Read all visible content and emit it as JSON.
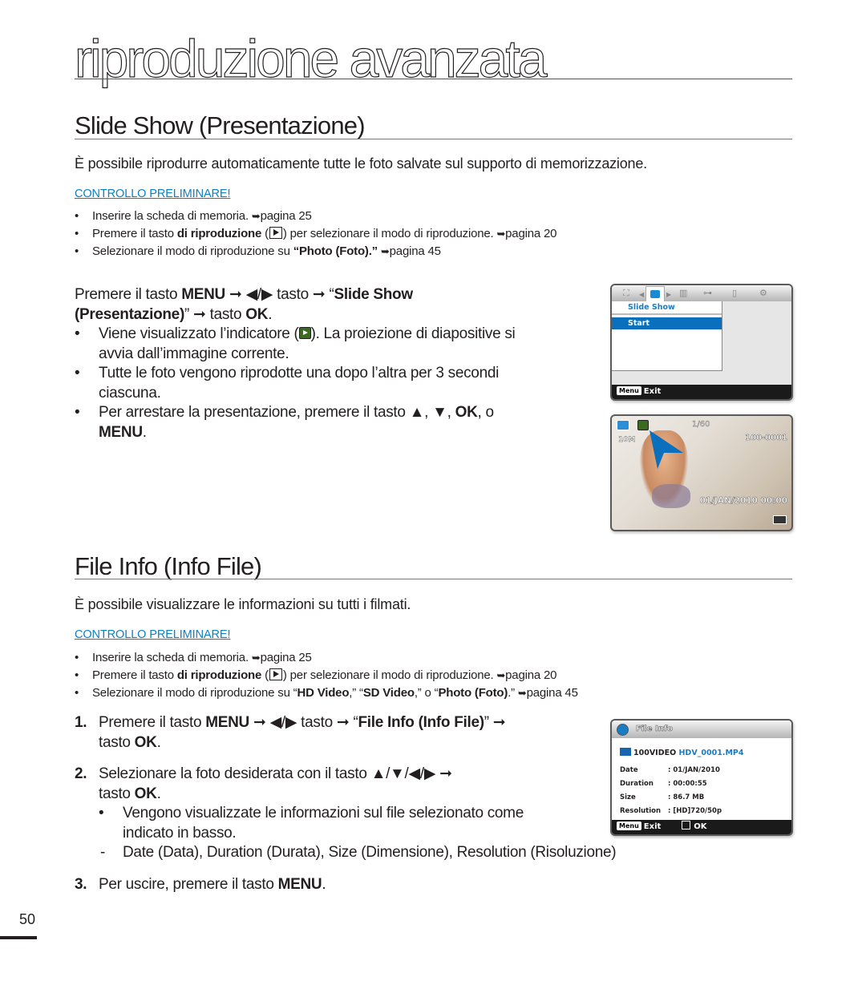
{
  "chapter_title": "riproduzione avanzata",
  "page_number": "50",
  "sections": [
    {
      "title": "Slide Show (Presentazione)",
      "intro": "È possibile riprodurre automaticamente tutte le foto salvate sul supporto di memorizzazione.",
      "precheck_label": "CONTROLLO PRELIMINARE!",
      "precheck_items": [
        {
          "pre": "Inserire la scheda di memoria. ",
          "ref": "pagina 25"
        },
        {
          "pre": "Premere il tasto ",
          "bold": "di riproduzione",
          "mid": ") per selezionare il modo di riproduzione. ",
          "ref": "pagina 20"
        },
        {
          "pre": "Selezionare il modo di riproduzione su ",
          "bold": "“Photo (Foto).”",
          "ref": "pagina 45"
        }
      ],
      "step_line1": {
        "a": "Premere il tasto ",
        "menu": "MENU",
        "b": " tasto ",
        "c": "“",
        "item": "Slide Show"
      },
      "step_line2": {
        "item": "(Presentazione)",
        "a": "” ",
        "b": " tasto ",
        "ok": "OK",
        "end": "."
      },
      "bullets": [
        {
          "pre": "Viene visualizzato l’indicatore (",
          "post": "). La proiezione di diapositive si",
          "cont": "avvia dall’immagine corrente."
        },
        {
          "pre": "Tutte le foto vengono riprodotte una dopo l’altra per 3 secondi",
          "cont": "ciascuna."
        },
        {
          "pre": "Per arrestare la presentazione, premere il tasto ▲, ▼, ",
          "ok": "OK",
          "post": ", o",
          "menu": "MENU",
          "end": "."
        }
      ],
      "menu_screen": {
        "menu_title": "Slide Show",
        "menu_option": "Start",
        "exit_key": "Menu",
        "exit_label": "Exit",
        "tab_icons": [
          "photo-mode-icon",
          "slideshow-icon",
          "delete-icon",
          "protect-key-icon",
          "file-info-icon",
          "settings-gear-icon"
        ]
      },
      "playback_screen": {
        "counter": "1/60",
        "resolution_badge": "10M",
        "file_number": "100-0001",
        "datetime": "01/JAN/2010 00:00"
      }
    },
    {
      "title": "File Info (Info File)",
      "intro": "È possibile visualizzare le informazioni su tutti i filmati.",
      "precheck_label": "CONTROLLO PRELIMINARE!",
      "precheck_items": [
        {
          "pre": "Inserire la scheda di memoria. ",
          "ref": "pagina 25"
        },
        {
          "pre": "Premere il tasto ",
          "bold": "di riproduzione",
          "mid": ") per selezionare il modo di riproduzione. ",
          "ref": "pagina 20"
        },
        {
          "pre": "Selezionare il modo di riproduzione su “",
          "b1": "HD Video",
          "m1": ",” “",
          "b2": "SD Video",
          "m2": ",” o “",
          "b3": "Photo (Foto)",
          "m3": ".” ",
          "ref": "pagina 45"
        }
      ],
      "steps": [
        {
          "num": "1.",
          "a": "Premere il tasto ",
          "menu": "MENU",
          "b": " tasto ",
          "c": "“",
          "item": "File Info (Info File)",
          "d": "” ",
          "cont": "tasto ",
          "ok": "OK",
          "end": "."
        },
        {
          "num": "2.",
          "a": "Selezionare la foto desiderata con il tasto ▲/▼/◀/▶ ",
          "cont": "tasto ",
          "ok": "OK",
          "end": ".",
          "bullet": "Vengono visualizzate le informazioni sul file selezionato come",
          "bullet_cont": "indicato in basso.",
          "dash": "Date (Data), Duration (Durata), Size (Dimensione), Resolution (Risoluzione)"
        },
        {
          "num": "3.",
          "a": "Per uscire, premere il tasto ",
          "menu": "MENU",
          "end": "."
        }
      ],
      "info_screen": {
        "title": "File Info",
        "folder": "100VIDEO",
        "filename": "HDV_0001.MP4",
        "rows": [
          {
            "label": "Date",
            "value": "01/JAN/2010"
          },
          {
            "label": "Duration",
            "value": "00:00:55"
          },
          {
            "label": "Size",
            "value": "86.7 MB"
          },
          {
            "label": "Resolution",
            "value": "[HD]720/50p"
          }
        ],
        "exit_key": "Menu",
        "exit_label": "Exit",
        "ok_label": "OK"
      }
    }
  ],
  "colors": {
    "accent_blue": "#0a7fc6",
    "menu_highlight": "#0a6fbd",
    "text": "#231f20",
    "indicator_green": "#3a6b1e"
  }
}
